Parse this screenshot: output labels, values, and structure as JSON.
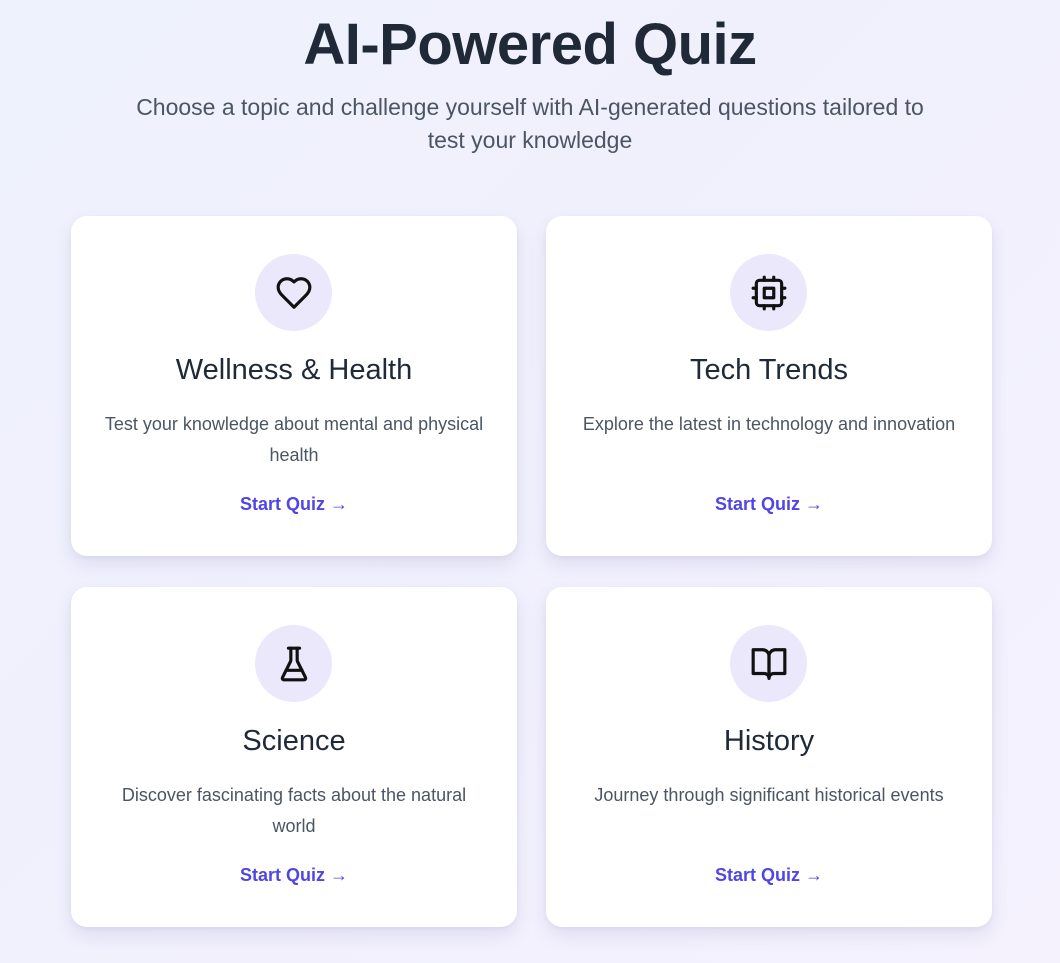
{
  "header": {
    "title": "AI-Powered Quiz",
    "subtitle": "Choose a topic and challenge yourself with AI-generated questions tailored to test your knowledge"
  },
  "cards": [
    {
      "icon": "heart-icon",
      "title": "Wellness & Health",
      "description": "Test your knowledge about mental and physical health",
      "cta": "Start Quiz →"
    },
    {
      "icon": "cpu-chip-icon",
      "title": "Tech Trends",
      "description": "Explore the latest in technology and innovation",
      "cta": "Start Quiz →"
    },
    {
      "icon": "flask-icon",
      "title": "Science",
      "description": "Discover fascinating facts about the natural world",
      "cta": "Start Quiz →"
    },
    {
      "icon": "open-book-icon",
      "title": "History",
      "description": "Journey through significant historical events",
      "cta": "Start Quiz →"
    }
  ],
  "colors": {
    "accent": "#4f46e5",
    "icon_background": "#ebe8fc",
    "heading": "#1f2937",
    "body_text": "#4b5563",
    "card_background": "#ffffff"
  }
}
